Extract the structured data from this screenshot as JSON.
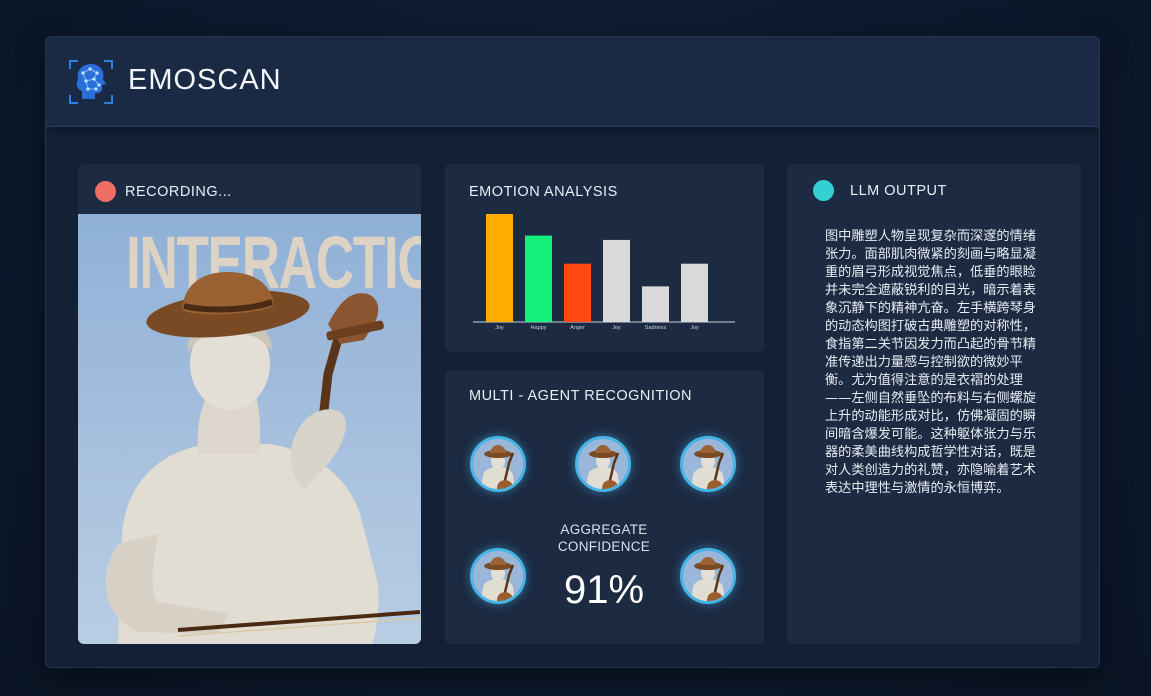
{
  "app": {
    "title": "EMOSCAN",
    "logo_icon": "ai-head-scan-icon"
  },
  "recording": {
    "label": "RECORDING...",
    "status_color": "#ef6f64",
    "image_text": "INTERACTION"
  },
  "emotion_analysis": {
    "title": "EMOTION ANALYSIS"
  },
  "multi_agent": {
    "title": "MULTI - AGENT RECOGNITION",
    "aggregate_label_line1": "AGGREGATE",
    "aggregate_label_line2": "CONFIDENCE",
    "aggregate_value": "91%",
    "agent_count": 5
  },
  "llm_output": {
    "title": "LLM OUTPUT",
    "status_color": "#34d1d4",
    "text": "图中雕塑人物呈现复杂而深邃的情绪张力。面部肌肉微紧的刻画与略显凝重的眉弓形成视觉焦点，低垂的眼睑并未完全遮蔽锐利的目光，暗示着表象沉静下的精神亢奋。左手横跨琴身的动态构图打破古典雕塑的对称性，食指第二关节因发力而凸起的骨节精准传递出力量感与控制欲的微妙平衡。尤为值得注意的是衣褶的处理——左侧自然垂坠的布料与右侧螺旋上升的动能形成对比，仿佛凝固的瞬间暗含爆发可能。这种躯体张力与乐器的柔美曲线构成哲学性对话，既是对人类创造力的礼赞，亦隐喻着艺术表达中理性与激情的永恒博弈。"
  },
  "chart_data": {
    "type": "bar",
    "categories": [
      "Joy",
      "Happy",
      "Anger",
      "Joy",
      "Sadness",
      "Joy"
    ],
    "values": [
      100,
      80,
      54,
      76,
      33,
      54
    ],
    "colors": [
      "#ffab00",
      "#17f07a",
      "#ff4a12",
      "#d9d9d9",
      "#d9d9d9",
      "#d9d9d9"
    ],
    "ylim": [
      0,
      100
    ],
    "title": "EMOTION ANALYSIS",
    "xlabel": "",
    "ylabel": "",
    "grid": false
  }
}
